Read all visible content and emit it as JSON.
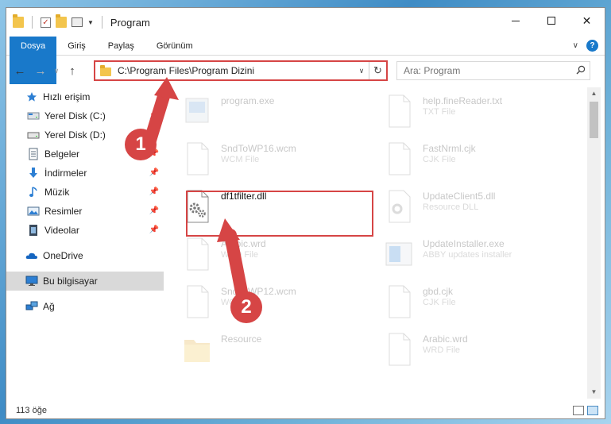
{
  "window": {
    "title": "Program",
    "controls": {
      "minimize": "minimize",
      "maximize": "maximize",
      "close": "✕"
    }
  },
  "ribbon": {
    "tabs": [
      {
        "label": "Dosya",
        "active": true
      },
      {
        "label": "Giriş"
      },
      {
        "label": "Paylaş"
      },
      {
        "label": "Görünüm"
      }
    ],
    "help": "?"
  },
  "nav": {
    "back": "←",
    "forward": "→",
    "recent": "∨",
    "up": "↑",
    "address": "C:\\Program Files\\Program Dizini",
    "search_placeholder": "Ara: Program"
  },
  "sidebar": {
    "items": [
      {
        "label": "Hızlı erişim",
        "icon": "star-icon",
        "section": true
      },
      {
        "label": "Yerel Disk (C:)",
        "icon": "drive-icon",
        "pinned": true
      },
      {
        "label": "Yerel Disk (D:)",
        "icon": "drive-icon",
        "pinned": true
      },
      {
        "label": "Belgeler",
        "icon": "documents-icon",
        "pinned": true
      },
      {
        "label": "İndirmeler",
        "icon": "downloads-icon",
        "pinned": true
      },
      {
        "label": "Müzik",
        "icon": "music-icon",
        "pinned": true
      },
      {
        "label": "Resimler",
        "icon": "pictures-icon",
        "pinned": true
      },
      {
        "label": "Videolar",
        "icon": "videos-icon",
        "pinned": true
      },
      {
        "label": "OneDrive",
        "icon": "cloud-icon",
        "section": true
      },
      {
        "label": "Bu bilgisayar",
        "icon": "computer-icon",
        "section": true,
        "selected": true
      },
      {
        "label": "Ağ",
        "icon": "network-icon",
        "section": true
      }
    ]
  },
  "files": {
    "left": [
      {
        "name": "program.exe",
        "type": "",
        "kind": "exe",
        "faded": true
      },
      {
        "name": "SndToWP16.wcm",
        "type": "WCM File",
        "kind": "doc",
        "faded": true
      },
      {
        "name": "df1tfilter.dll",
        "type": "",
        "kind": "dll",
        "faded": false
      },
      {
        "name": "Arabic.wrd",
        "type": "WRD File",
        "kind": "doc",
        "faded": true
      },
      {
        "name": "SndToWP12.wcm",
        "type": "WCM File",
        "kind": "doc",
        "faded": true
      },
      {
        "name": "Resource",
        "type": "",
        "kind": "folder",
        "faded": true
      }
    ],
    "right": [
      {
        "name": "help.fineReader.txt",
        "type": "TXT File",
        "kind": "doc",
        "faded": true
      },
      {
        "name": "FastNrml.cjk",
        "type": "CJK File",
        "kind": "doc",
        "faded": true
      },
      {
        "name": "UpdateClient5.dll",
        "type": "Resource DLL",
        "kind": "dll",
        "faded": true
      },
      {
        "name": "UpdateInstaller.exe",
        "type": "ABBY updates installer",
        "kind": "installer",
        "faded": true
      },
      {
        "name": "gbd.cjk",
        "type": "CJK File",
        "kind": "doc",
        "faded": true
      },
      {
        "name": "Arabic.wrd",
        "type": "WRD File",
        "kind": "doc",
        "faded": true
      }
    ]
  },
  "status": {
    "count": "113 öğe"
  },
  "annotations": {
    "step1": "1",
    "step2": "2",
    "color": "#d64545"
  },
  "colors": {
    "accent": "#1979ca",
    "highlight": "#d64545"
  }
}
